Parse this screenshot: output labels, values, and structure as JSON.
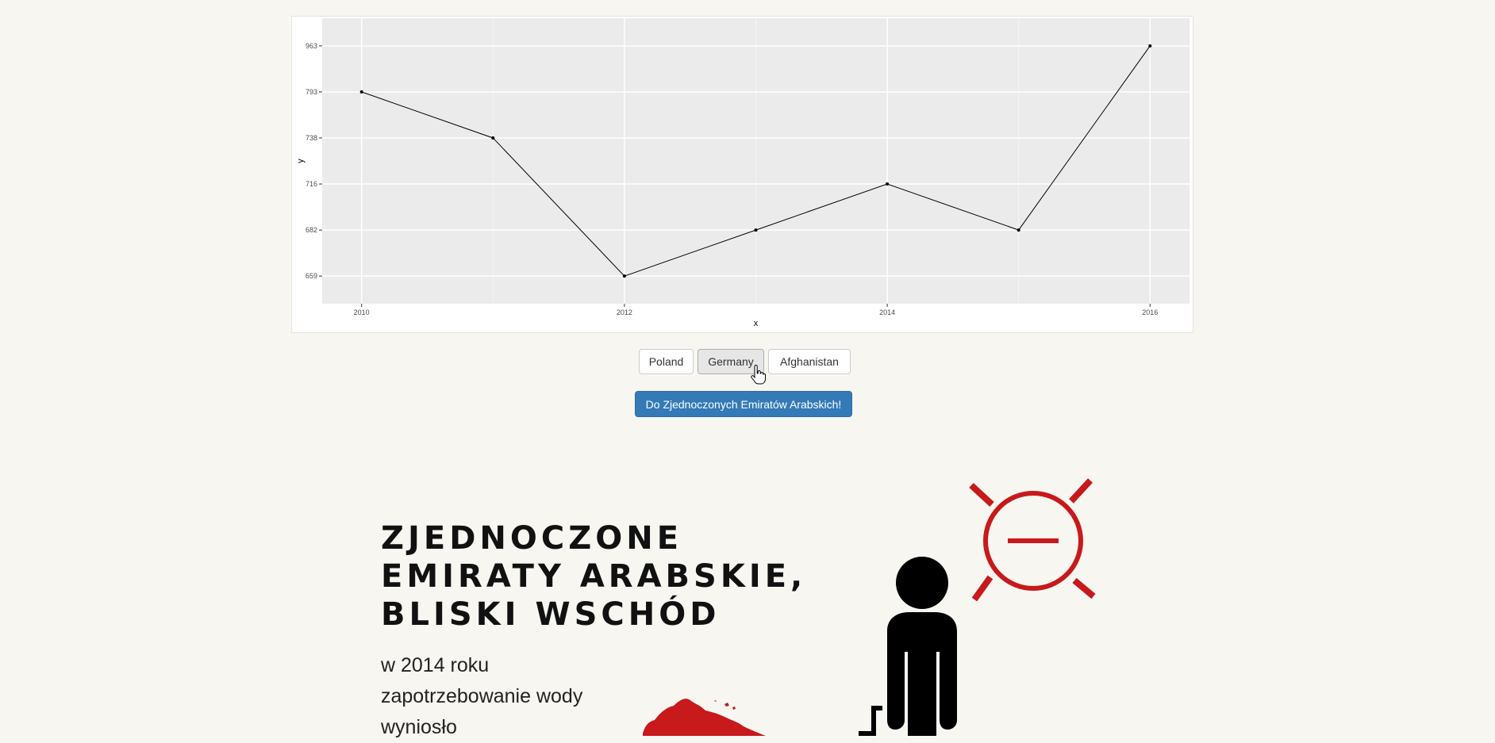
{
  "chart_data": {
    "type": "line",
    "x": [
      2010,
      2011,
      2012,
      2013,
      2014,
      2015,
      2016
    ],
    "y": [
      793,
      738,
      659,
      682,
      716,
      682,
      963
    ],
    "y_axis_ticks": [
      659,
      682,
      716,
      738,
      793,
      963
    ],
    "x_axis_ticks": [
      2010,
      2012,
      2014,
      2016
    ],
    "xlabel": "x",
    "ylabel": "y",
    "y_scale": "categorical",
    "grid": true,
    "line_color": "#000000",
    "background": "#ebebeb"
  },
  "country_buttons": {
    "poland": "Poland",
    "germany": "Germany",
    "afghanistan": "Afghanistan",
    "selected": "Germany"
  },
  "cta_label": "Do Zjednoczonych Emiratów Arabskich!",
  "section": {
    "title_lines": [
      "ZJEDNOCZONE",
      "EMIRATY ARABSKIE,",
      "BLISKI WSCHÓD"
    ],
    "body_lines": [
      "w 2014 roku",
      "zapotrzebowanie wody",
      "wyniosło"
    ]
  },
  "colors": {
    "accent_red": "#c8191b",
    "button_blue": "#337ab7",
    "page_background": "#f7f6f1"
  },
  "icons": {
    "sun": "sun-minus-icon",
    "person": "person-icon",
    "map": "map-region-shape",
    "cursor": "hand-pointer-icon"
  }
}
